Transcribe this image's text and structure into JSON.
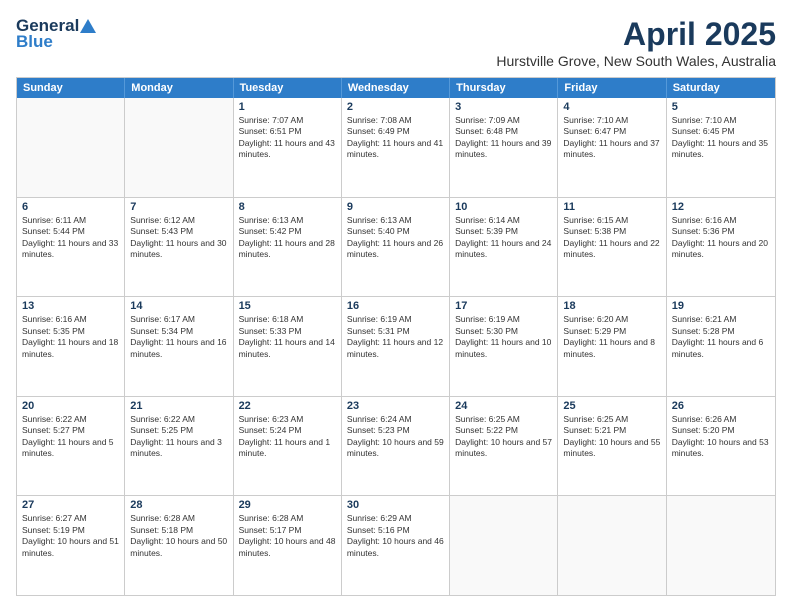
{
  "header": {
    "logo_line1": "General",
    "logo_line2": "Blue",
    "month": "April 2025",
    "location": "Hurstville Grove, New South Wales, Australia"
  },
  "weekdays": [
    "Sunday",
    "Monday",
    "Tuesday",
    "Wednesday",
    "Thursday",
    "Friday",
    "Saturday"
  ],
  "weeks": [
    [
      {
        "day": "",
        "info": ""
      },
      {
        "day": "",
        "info": ""
      },
      {
        "day": "1",
        "info": "Sunrise: 7:07 AM\nSunset: 6:51 PM\nDaylight: 11 hours and 43 minutes."
      },
      {
        "day": "2",
        "info": "Sunrise: 7:08 AM\nSunset: 6:49 PM\nDaylight: 11 hours and 41 minutes."
      },
      {
        "day": "3",
        "info": "Sunrise: 7:09 AM\nSunset: 6:48 PM\nDaylight: 11 hours and 39 minutes."
      },
      {
        "day": "4",
        "info": "Sunrise: 7:10 AM\nSunset: 6:47 PM\nDaylight: 11 hours and 37 minutes."
      },
      {
        "day": "5",
        "info": "Sunrise: 7:10 AM\nSunset: 6:45 PM\nDaylight: 11 hours and 35 minutes."
      }
    ],
    [
      {
        "day": "6",
        "info": "Sunrise: 6:11 AM\nSunset: 5:44 PM\nDaylight: 11 hours and 33 minutes."
      },
      {
        "day": "7",
        "info": "Sunrise: 6:12 AM\nSunset: 5:43 PM\nDaylight: 11 hours and 30 minutes."
      },
      {
        "day": "8",
        "info": "Sunrise: 6:13 AM\nSunset: 5:42 PM\nDaylight: 11 hours and 28 minutes."
      },
      {
        "day": "9",
        "info": "Sunrise: 6:13 AM\nSunset: 5:40 PM\nDaylight: 11 hours and 26 minutes."
      },
      {
        "day": "10",
        "info": "Sunrise: 6:14 AM\nSunset: 5:39 PM\nDaylight: 11 hours and 24 minutes."
      },
      {
        "day": "11",
        "info": "Sunrise: 6:15 AM\nSunset: 5:38 PM\nDaylight: 11 hours and 22 minutes."
      },
      {
        "day": "12",
        "info": "Sunrise: 6:16 AM\nSunset: 5:36 PM\nDaylight: 11 hours and 20 minutes."
      }
    ],
    [
      {
        "day": "13",
        "info": "Sunrise: 6:16 AM\nSunset: 5:35 PM\nDaylight: 11 hours and 18 minutes."
      },
      {
        "day": "14",
        "info": "Sunrise: 6:17 AM\nSunset: 5:34 PM\nDaylight: 11 hours and 16 minutes."
      },
      {
        "day": "15",
        "info": "Sunrise: 6:18 AM\nSunset: 5:33 PM\nDaylight: 11 hours and 14 minutes."
      },
      {
        "day": "16",
        "info": "Sunrise: 6:19 AM\nSunset: 5:31 PM\nDaylight: 11 hours and 12 minutes."
      },
      {
        "day": "17",
        "info": "Sunrise: 6:19 AM\nSunset: 5:30 PM\nDaylight: 11 hours and 10 minutes."
      },
      {
        "day": "18",
        "info": "Sunrise: 6:20 AM\nSunset: 5:29 PM\nDaylight: 11 hours and 8 minutes."
      },
      {
        "day": "19",
        "info": "Sunrise: 6:21 AM\nSunset: 5:28 PM\nDaylight: 11 hours and 6 minutes."
      }
    ],
    [
      {
        "day": "20",
        "info": "Sunrise: 6:22 AM\nSunset: 5:27 PM\nDaylight: 11 hours and 5 minutes."
      },
      {
        "day": "21",
        "info": "Sunrise: 6:22 AM\nSunset: 5:25 PM\nDaylight: 11 hours and 3 minutes."
      },
      {
        "day": "22",
        "info": "Sunrise: 6:23 AM\nSunset: 5:24 PM\nDaylight: 11 hours and 1 minute."
      },
      {
        "day": "23",
        "info": "Sunrise: 6:24 AM\nSunset: 5:23 PM\nDaylight: 10 hours and 59 minutes."
      },
      {
        "day": "24",
        "info": "Sunrise: 6:25 AM\nSunset: 5:22 PM\nDaylight: 10 hours and 57 minutes."
      },
      {
        "day": "25",
        "info": "Sunrise: 6:25 AM\nSunset: 5:21 PM\nDaylight: 10 hours and 55 minutes."
      },
      {
        "day": "26",
        "info": "Sunrise: 6:26 AM\nSunset: 5:20 PM\nDaylight: 10 hours and 53 minutes."
      }
    ],
    [
      {
        "day": "27",
        "info": "Sunrise: 6:27 AM\nSunset: 5:19 PM\nDaylight: 10 hours and 51 minutes."
      },
      {
        "day": "28",
        "info": "Sunrise: 6:28 AM\nSunset: 5:18 PM\nDaylight: 10 hours and 50 minutes."
      },
      {
        "day": "29",
        "info": "Sunrise: 6:28 AM\nSunset: 5:17 PM\nDaylight: 10 hours and 48 minutes."
      },
      {
        "day": "30",
        "info": "Sunrise: 6:29 AM\nSunset: 5:16 PM\nDaylight: 10 hours and 46 minutes."
      },
      {
        "day": "",
        "info": ""
      },
      {
        "day": "",
        "info": ""
      },
      {
        "day": "",
        "info": ""
      }
    ]
  ]
}
